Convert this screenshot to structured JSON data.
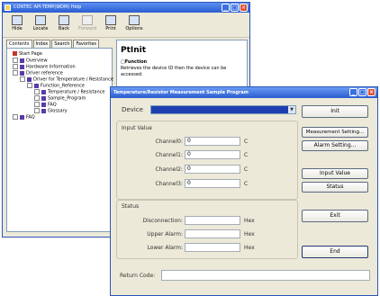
{
  "help_window": {
    "title": "CONTEC API-TEMP(WDM) Help",
    "toolbar": [
      {
        "label": "Hide",
        "icon": "hide-icon",
        "enabled": true
      },
      {
        "label": "Locate",
        "icon": "locate-icon",
        "enabled": true
      },
      {
        "label": "Back",
        "icon": "back-arrow-icon",
        "enabled": true
      },
      {
        "label": "Forward",
        "icon": "forward-arrow-icon",
        "enabled": false
      },
      {
        "label": "Print",
        "icon": "printer-icon",
        "enabled": true
      },
      {
        "label": "Options",
        "icon": "options-icon",
        "enabled": true
      }
    ],
    "tabs": [
      "Contents",
      "Index",
      "Search",
      "Favorites"
    ],
    "tree": [
      {
        "label": "Start Page",
        "level": 1
      },
      {
        "label": "Overview",
        "level": 1
      },
      {
        "label": "Hardware Information",
        "level": 1
      },
      {
        "label": "Driver reference",
        "level": 1
      },
      {
        "label": "Driver for Temperature / Resistance",
        "level": 2
      },
      {
        "label": "Function_Reference",
        "level": 3
      },
      {
        "label": "Temperature / Resistance",
        "level": 4
      },
      {
        "label": "Sample_Program",
        "level": 4
      },
      {
        "label": "FAQ",
        "level": 4
      },
      {
        "label": "Glossary",
        "level": 4
      },
      {
        "label": "FAQ",
        "level": 1
      }
    ],
    "content": {
      "title": "PtInit",
      "section": "□Function",
      "description": "Retrieves the device ID then the device can be accessed."
    }
  },
  "dialog": {
    "title": "Temperature/Resistor Measurement Sample Program",
    "device_label": "Device",
    "device_value": "",
    "input_group_label": "Input Value",
    "channels": [
      {
        "label": "Channel0:",
        "value": "0",
        "unit": "C"
      },
      {
        "label": "Channel1:",
        "value": "0",
        "unit": "C"
      },
      {
        "label": "Channel2:",
        "value": "0",
        "unit": "C"
      },
      {
        "label": "Channel3:",
        "value": "0",
        "unit": "C"
      }
    ],
    "status_group_label": "Status",
    "status_fields": [
      {
        "label": "Disconnection:",
        "value": "",
        "unit": "Hex"
      },
      {
        "label": "Upper Alarm:",
        "value": "",
        "unit": "Hex"
      },
      {
        "label": "Lower Alarm:",
        "value": "",
        "unit": "Hex"
      }
    ],
    "return_code_label": "Return Code:",
    "return_code_value": "",
    "buttons": {
      "init": "Init",
      "measurement_setting": "Measurement Setting...",
      "alarm_setting": "Alarm Setting...",
      "input_value": "Input Value",
      "status": "Status",
      "exit": "Exit",
      "end": "End"
    }
  },
  "colors": {
    "title_bar": "#2b5ccf",
    "device_selection": "#1e3fb0",
    "window_bg": "#ece9d8"
  }
}
